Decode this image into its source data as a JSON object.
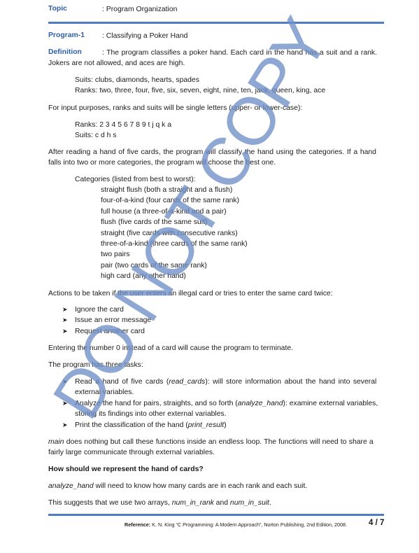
{
  "header": {
    "topic_label": "Topic",
    "topic_value": ": Program Organization"
  },
  "program": {
    "label": "Program-1",
    "value": ": Classifying a Poker Hand"
  },
  "definition": {
    "label": "Definition",
    "line1": ": The program classifies a poker hand. Each card in the hand has a suit and a rank.",
    "line2": "Jokers are not allowed, and aces are high."
  },
  "suits_words": "Suits: clubs, diamonds, hearts, spades",
  "ranks_words": "Ranks: two, three, four, five, six, seven, eight, nine, ten, jack, queen, king, ace",
  "input_intro": "For input purposes, ranks and suits will be single letters (upper- or lower-case):",
  "ranks_letters": "Ranks: 2 3 4 5 6 7 8 9 t j q k a",
  "suits_letters": "Suits: c d h s",
  "after_reading": {
    "line1": "After reading a hand of five cards, the program will classify the hand using the categories. If a hand",
    "line2": "falls into two or more categories, the program will choose the best one."
  },
  "categories": {
    "heading": "Categories (listed from best to worst):",
    "items": [
      "straight flush (both a straight and a flush)",
      "four-of-a-kind (four cards of the same rank)",
      "full house (a three-of-a-kind and a pair)",
      "flush (five cards of the same suit)",
      "straight (five cards with consecutive ranks)",
      "three-of-a-kind (three cards of the same rank)",
      "two pairs",
      "pair (two cards of the same rank)",
      "high card (any other hand)"
    ]
  },
  "actions": {
    "intro": "Actions to be taken if the user enters an illegal card or tries to enter the same card twice:",
    "items": [
      "Ignore the card",
      "Issue an error message",
      "Request another card"
    ]
  },
  "terminate_text": "Entering the number 0 instead of a card will cause the program to terminate.",
  "tasks": {
    "intro": "The program has three tasks:",
    "t1_a": "Read a hand of five cards (",
    "t1_fn": "read_cards",
    "t1_b": "): will store information about the hand into several",
    "t1_c": "external variables.",
    "t2_a": "Analyze the hand for pairs, straights, and so forth (",
    "t2_fn": "analyze_hand",
    "t2_b": "): examine external variables,",
    "t2_c": "storing its findings into other external variables.",
    "t3_a": "Print the classification of the hand (",
    "t3_fn": "print_result",
    "t3_b": ")"
  },
  "main_para": {
    "fn": "main",
    "line1_rest": " does nothing but call these functions inside an endless loop. The functions will need to share a",
    "line2": "fairly large communicate through external variables."
  },
  "question": "How should we represent the hand of cards?",
  "analyze_para": {
    "fn": "analyze_hand",
    "rest": " will need to know how many cards are in each rank and each suit."
  },
  "arrays_para": {
    "a": "This suggests that we use two arrays, ",
    "fn1": "num_in_rank",
    "mid": " and ",
    "fn2": "num_in_suit",
    "end": "."
  },
  "footer": {
    "ref_label": "Reference:",
    "ref_text": " K. N. King “C Programming: A Modern Approach”, Norton Publishing, 2nd Edition, 2008.",
    "page": "4 / 7"
  },
  "watermark": {
    "text": "DO NOT COPY",
    "color": "#6e8fc7"
  },
  "colors": {
    "accent": "#2e5fa8",
    "rule": "#4f7ac6"
  }
}
